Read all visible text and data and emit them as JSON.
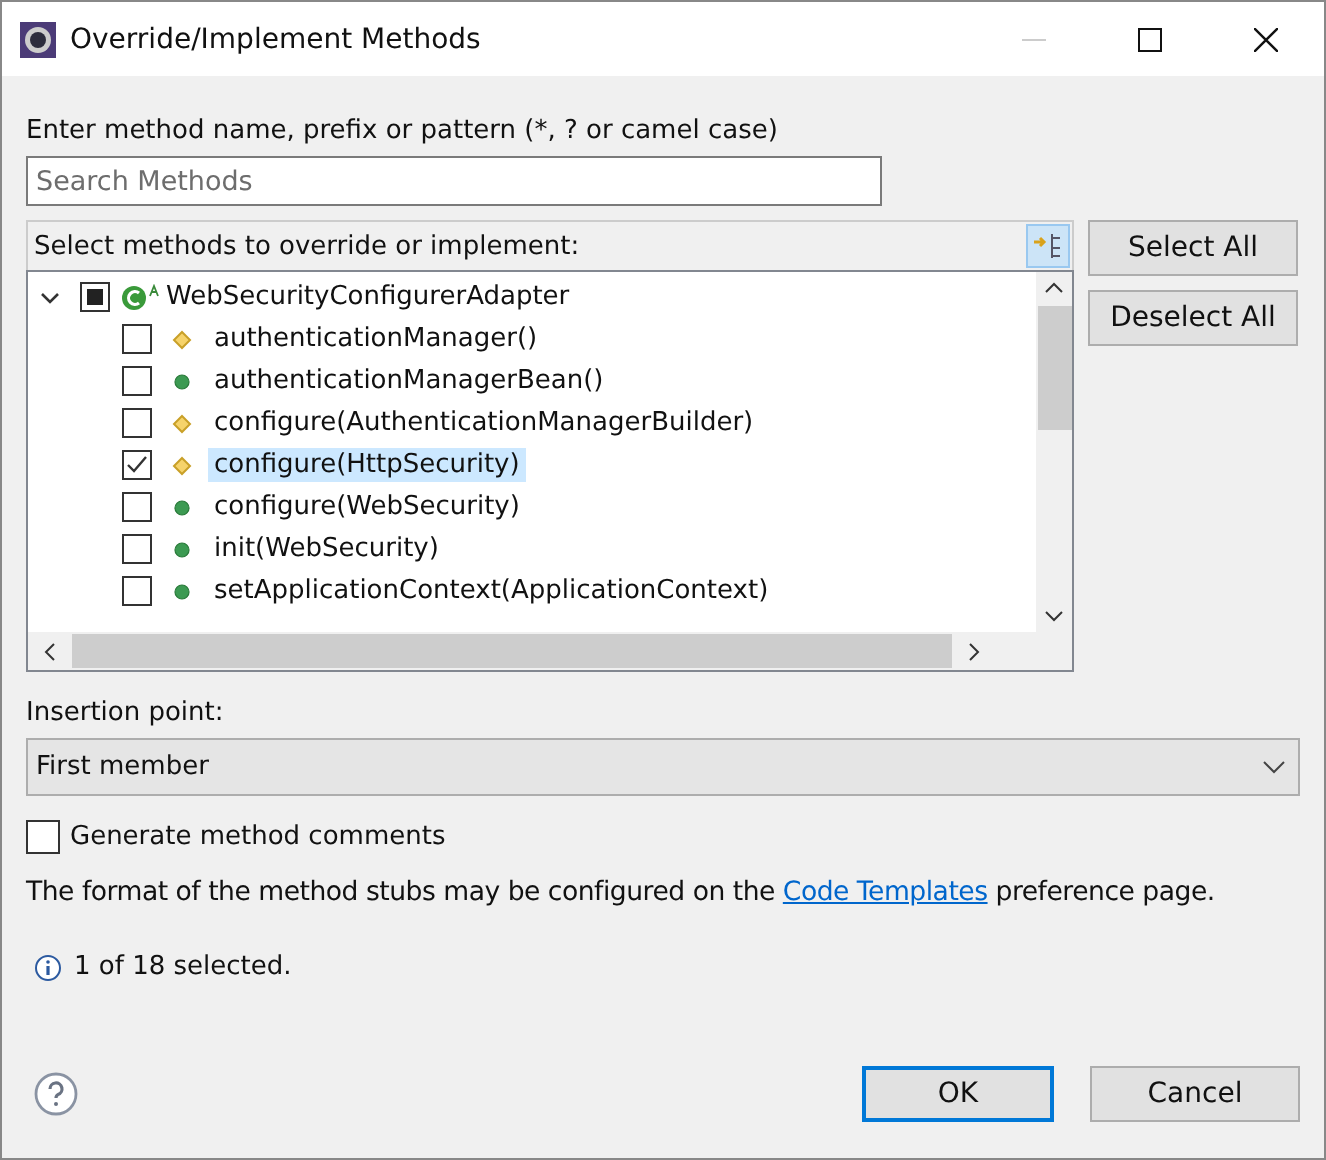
{
  "window": {
    "title": "Override/Implement Methods"
  },
  "filter": {
    "label": "Enter method name, prefix or pattern (*, ? or camel case)",
    "placeholder": "Search Methods"
  },
  "methods": {
    "label": "Select methods to override or implement:",
    "tree": [
      {
        "label": "WebSecurityConfigurerAdapter",
        "checked": false,
        "partial": true,
        "expanded": true,
        "selected": false,
        "children": [
          {
            "label": "authenticationManager()",
            "kind": "protected",
            "checked": false,
            "selected": false
          },
          {
            "label": "authenticationManagerBean()",
            "kind": "public",
            "checked": false,
            "selected": false
          },
          {
            "label": "configure(AuthenticationManagerBuilder)",
            "kind": "protected",
            "checked": false,
            "selected": false
          },
          {
            "label": "configure(HttpSecurity)",
            "kind": "protected",
            "checked": true,
            "selected": true
          },
          {
            "label": "configure(WebSecurity)",
            "kind": "public",
            "checked": false,
            "selected": false
          },
          {
            "label": "init(WebSecurity)",
            "kind": "public",
            "checked": false,
            "selected": false
          },
          {
            "label": "setApplicationContext(ApplicationContext)",
            "kind": "public",
            "checked": false,
            "selected": false
          }
        ]
      }
    ]
  },
  "side_buttons": [
    "Select All",
    "Deselect All"
  ],
  "insertion": {
    "label": "Insertion point:",
    "value": "First member"
  },
  "generate_comments": {
    "label": "Generate method comments",
    "checked": false
  },
  "note": {
    "before": "The format of the method stubs may be configured on the ",
    "link": "Code Templates",
    "after": " preference page."
  },
  "status": "1 of 18 selected.",
  "buttons": [
    {
      "label": "OK",
      "default": true
    },
    {
      "label": "Cancel",
      "default": false
    }
  ]
}
